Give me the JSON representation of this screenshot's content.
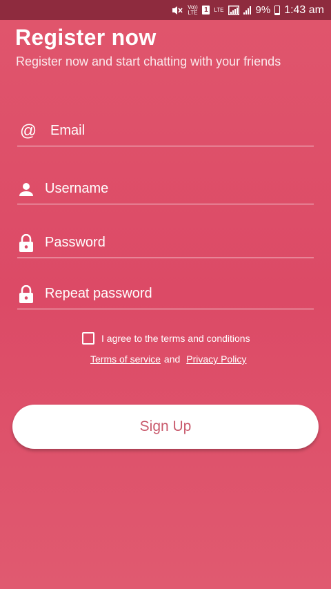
{
  "status_bar": {
    "volte_label": "Vo)) LTE",
    "sim_label": "1",
    "lte_label": "LTE",
    "battery_percent": "9%",
    "time": "1:43 am"
  },
  "header": {
    "title": "Register now",
    "subtitle": "Register now and start chatting with your friends"
  },
  "form": {
    "email_label": "Email",
    "username_label": "Username",
    "password_label": "Password",
    "repeat_password_label": "Repeat password"
  },
  "terms": {
    "agree_label": "I agree to the terms and conditions",
    "terms_of_service": "Terms of service",
    "and": "and",
    "privacy_policy": "Privacy Policy",
    "checked": false
  },
  "actions": {
    "signup_label": "Sign Up"
  },
  "colors": {
    "background": "#dc4a66",
    "status_bar": "#8e2b3e",
    "button_text": "#c95b6d"
  }
}
